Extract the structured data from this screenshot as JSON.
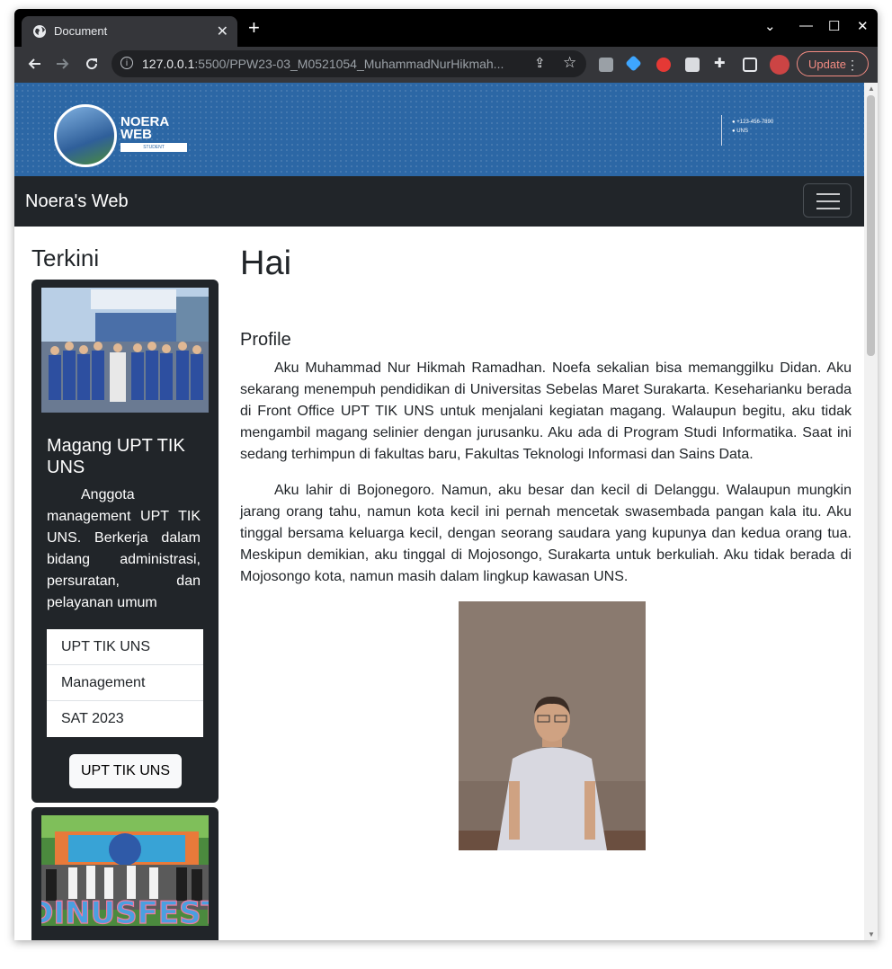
{
  "browser": {
    "tab_title": "Document",
    "tab_close": "✕",
    "new_tab": "+",
    "url_host": "127.0.0.1",
    "url_rest": ":5500/PPW23-03_M0521054_MuhammadNurHikmah...",
    "update_label": "Update",
    "win_controls": {
      "dropdown": "⌄",
      "minimize": "—",
      "maximize": "☐",
      "close": "✕"
    }
  },
  "banner": {
    "logo_line1": "NOERA",
    "logo_line2": "WEB",
    "logo_tag": "STUDENT",
    "phone": "+123-456-7890",
    "location": "UNS"
  },
  "navbar": {
    "brand": "Noera's Web"
  },
  "sidebar": {
    "title": "Terkini",
    "cards": [
      {
        "title": "Magang UPT TIK UNS",
        "text": "Anggota management UPT TIK UNS. Berkerja dalam bidang administrasi, persuratan, dan pelayanan umum",
        "list": [
          "UPT TIK UNS",
          "Management",
          "SAT 2023"
        ],
        "button": "UPT TIK UNS"
      },
      {
        "image_text": "DINUSFEST"
      }
    ]
  },
  "main": {
    "title": "Hai",
    "section": "Profile",
    "paragraphs": [
      "Aku Muhammad Nur Hikmah Ramadhan. Noefa sekalian bisa memanggilku Didan. Aku sekarang menempuh pendidikan di Universitas Sebelas Maret Surakarta. Keseharianku berada di Front Office UPT TIK UNS untuk menjalani kegiatan magang. Walaupun begitu, aku tidak mengambil magang selinier dengan jurusanku. Aku ada di Program Studi Informatika. Saat ini sedang terhimpun di fakultas baru, Fakultas Teknologi Informasi dan Sains Data.",
      "Aku lahir di Bojonegoro. Namun, aku besar dan kecil di Delanggu. Walaupun mungkin jarang orang tahu, namun kota kecil ini pernah mencetak swasembada pangan kala itu. Aku tinggal bersama keluarga kecil, dengan seorang saudara yang kupunya dan kedua orang tua. Meskipun demikian, aku tinggal di Mojosongo, Surakarta untuk berkuliah. Aku tidak berada di Mojosongo kota, namun masih dalam lingkup kawasan UNS."
    ]
  },
  "colors": {
    "banner_bg": "#2c67a5",
    "navbar_bg": "#212529",
    "card_bg": "#212529",
    "chrome_dark": "#35363a",
    "update_accent": "#f28b82"
  }
}
